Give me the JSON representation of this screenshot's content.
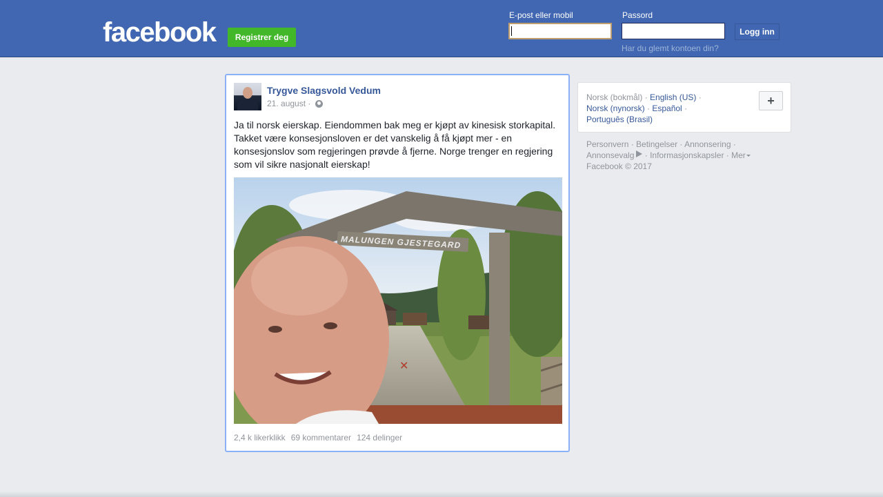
{
  "header": {
    "logo": "facebook",
    "register_label": "Registrer deg",
    "email_label": "E-post eller mobil",
    "password_label": "Passord",
    "login_label": "Logg inn",
    "forgot_label": "Har du glemt kontoen din?",
    "email_value": "",
    "password_value": ""
  },
  "post": {
    "author": "Trygve Slagsvold Vedum",
    "date": "21. august ·",
    "text": "Ja til norsk eierskap. Eiendommen bak meg er kjøpt av kinesisk storkapital. Takket være konsesjonsloven er det vanskelig å få kjøpt mer - en konsesjonslov som regjeringen prøvde å fjerne. Norge trenger en regjering som vil sikre nasjonalt eierskap!",
    "photo_sign": "MALUNGEN GJESTEGARD",
    "likes": "2,4 k likerklikk",
    "comments": "69 kommentarer",
    "shares": "124 delinger"
  },
  "languages": {
    "current": "Norsk (bokmål)",
    "options": [
      "English (US)",
      "Norsk (nynorsk)",
      "Español",
      "Português (Brasil)"
    ],
    "add_label": "+"
  },
  "footer": {
    "links": [
      "Personvern",
      "Betingelser",
      "Annonsering",
      "Annonsevalg",
      "Informasjonskapsler",
      "Mer"
    ],
    "copyright": "Facebook © 2017"
  },
  "colors": {
    "brand": "#4267b2",
    "register": "#42b72a",
    "link": "#365899",
    "muted": "#90949c"
  }
}
